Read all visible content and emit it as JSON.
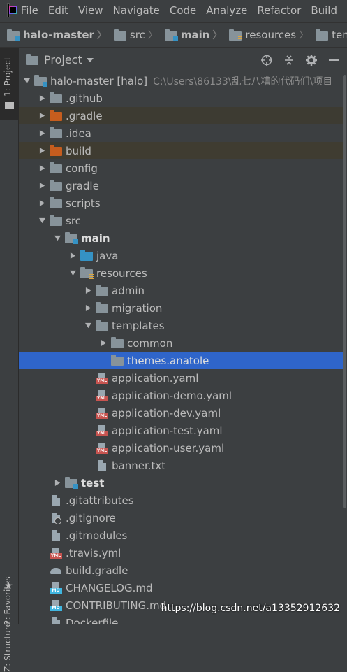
{
  "menubar": {
    "items": [
      {
        "u": "F",
        "rest": "ile"
      },
      {
        "u": "E",
        "rest": "dit"
      },
      {
        "u": "V",
        "rest": "iew"
      },
      {
        "u": "N",
        "rest": "avigate"
      },
      {
        "u": "C",
        "rest": "ode"
      },
      {
        "pre": "Analy",
        "u": "z",
        "rest": "e"
      },
      {
        "u": "R",
        "rest": "efactor"
      },
      {
        "u": "B",
        "rest": "uild"
      }
    ]
  },
  "breadcrumb": {
    "items": [
      "halo-master",
      "src",
      "main",
      "resources",
      "templates"
    ]
  },
  "left_strip": {
    "project_tab": "1: Project",
    "favorites_tab": "2: Favorites",
    "structure_tab": "Z: Structure"
  },
  "panel": {
    "title": "Project",
    "dropdown_icon": "chevron-down-icon",
    "tools": [
      "target-icon",
      "collapse-all-icon",
      "gear-icon",
      "minimize-icon"
    ]
  },
  "tree": {
    "root_label": "halo-master [halo]",
    "root_path": "C:\\Users\\86133\\乱七八糟的代码们\\项目",
    "rows": [
      {
        "label": ".github"
      },
      {
        "label": ".gradle"
      },
      {
        "label": ".idea"
      },
      {
        "label": "build"
      },
      {
        "label": "config"
      },
      {
        "label": "gradle"
      },
      {
        "label": "scripts"
      },
      {
        "label": "src"
      },
      {
        "label": "main"
      },
      {
        "label": "java"
      },
      {
        "label": "resources"
      },
      {
        "label": "admin"
      },
      {
        "label": "migration"
      },
      {
        "label": "templates"
      },
      {
        "label": "common"
      },
      {
        "label": "themes.anatole"
      },
      {
        "label": "application.yaml"
      },
      {
        "label": "application-demo.yaml"
      },
      {
        "label": "application-dev.yaml"
      },
      {
        "label": "application-test.yaml"
      },
      {
        "label": "application-user.yaml"
      },
      {
        "label": "banner.txt"
      },
      {
        "label": "test"
      },
      {
        "label": ".gitattributes"
      },
      {
        "label": ".gitignore"
      },
      {
        "label": ".gitmodules"
      },
      {
        "label": ".travis.yml"
      },
      {
        "label": "build.gradle"
      },
      {
        "label": "CHANGELOG.md"
      },
      {
        "label": "CONTRIBUTING.md"
      },
      {
        "label": "Dockerfile"
      }
    ]
  },
  "colors": {
    "background": "#3c3f41",
    "selection": "#2f65ca",
    "excluded_folder": "#c65d1e",
    "source_folder": "#3592c4"
  },
  "watermark": "https://blog.csdn.net/a13352912632"
}
